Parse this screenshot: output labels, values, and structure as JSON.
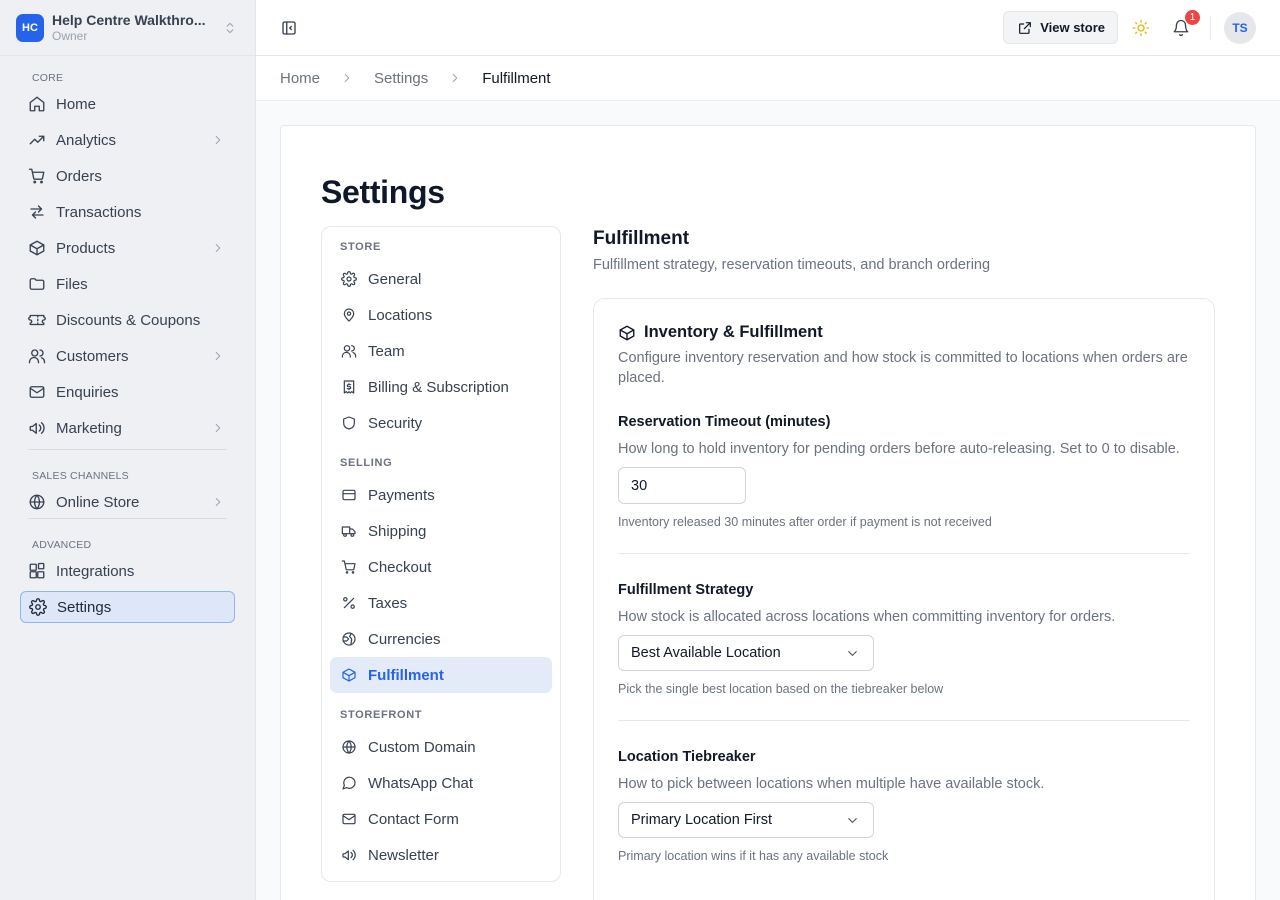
{
  "workspace": {
    "initials": "HC",
    "name": "Help Centre Walkthro...",
    "role": "Owner"
  },
  "sidebar": {
    "sections": [
      {
        "title": "CORE",
        "items": [
          {
            "label": "Home",
            "icon": "home-icon",
            "chevron": false
          },
          {
            "label": "Analytics",
            "icon": "trend-icon",
            "chevron": true
          },
          {
            "label": "Orders",
            "icon": "cart-icon",
            "chevron": false
          },
          {
            "label": "Transactions",
            "icon": "arrows-icon",
            "chevron": false
          },
          {
            "label": "Products",
            "icon": "box-icon",
            "chevron": true
          },
          {
            "label": "Files",
            "icon": "folder-icon",
            "chevron": false
          },
          {
            "label": "Discounts & Coupons",
            "icon": "ticket-icon",
            "chevron": false
          },
          {
            "label": "Customers",
            "icon": "users-icon",
            "chevron": true
          },
          {
            "label": "Enquiries",
            "icon": "mail-icon",
            "chevron": false
          },
          {
            "label": "Marketing",
            "icon": "megaphone-icon",
            "chevron": true
          }
        ]
      },
      {
        "title": "SALES CHANNELS",
        "items": [
          {
            "label": "Online Store",
            "icon": "globe-icon",
            "chevron": true
          }
        ]
      },
      {
        "title": "ADVANCED",
        "items": [
          {
            "label": "Integrations",
            "icon": "blocks-icon",
            "chevron": false
          },
          {
            "label": "Settings",
            "icon": "gear-icon",
            "chevron": false,
            "active": true
          }
        ]
      }
    ]
  },
  "topbar": {
    "view_store": "View store",
    "notifications_count": "1",
    "avatar_initials": "TS"
  },
  "breadcrumb": [
    "Home",
    "Settings",
    "Fulfillment"
  ],
  "page": {
    "title": "Settings"
  },
  "subnav": {
    "sections": [
      {
        "title": "STORE",
        "items": [
          {
            "label": "General",
            "icon": "gear-icon"
          },
          {
            "label": "Locations",
            "icon": "pin-icon"
          },
          {
            "label": "Team",
            "icon": "users-icon"
          },
          {
            "label": "Billing & Subscription",
            "icon": "receipt-icon"
          },
          {
            "label": "Security",
            "icon": "shield-icon"
          }
        ]
      },
      {
        "title": "SELLING",
        "items": [
          {
            "label": "Payments",
            "icon": "card-icon"
          },
          {
            "label": "Shipping",
            "icon": "truck-icon"
          },
          {
            "label": "Checkout",
            "icon": "cart-icon"
          },
          {
            "label": "Taxes",
            "icon": "percent-icon"
          },
          {
            "label": "Currencies",
            "icon": "coins-icon"
          },
          {
            "label": "Fulfillment",
            "icon": "box-icon",
            "active": true
          }
        ]
      },
      {
        "title": "STOREFRONT",
        "items": [
          {
            "label": "Custom Domain",
            "icon": "globe-icon"
          },
          {
            "label": "WhatsApp Chat",
            "icon": "chat-icon"
          },
          {
            "label": "Contact Form",
            "icon": "mail-icon"
          },
          {
            "label": "Newsletter",
            "icon": "megaphone-icon"
          }
        ]
      }
    ]
  },
  "content": {
    "title": "Fulfillment",
    "description": "Fulfillment strategy, reservation timeouts, and branch ordering",
    "panel": {
      "title": "Inventory & Fulfillment",
      "description": "Configure inventory reservation and how stock is committed to locations when orders are placed.",
      "reservation": {
        "label": "Reservation Timeout (minutes)",
        "description": "How long to hold inventory for pending orders before auto-releasing. Set to 0 to disable.",
        "value": "30",
        "hint": "Inventory released 30 minutes after order if payment is not received"
      },
      "strategy": {
        "label": "Fulfillment Strategy",
        "description": "How stock is allocated across locations when committing inventory for orders.",
        "value": "Best Available Location",
        "hint": "Pick the single best location based on the tiebreaker below"
      },
      "tiebreaker": {
        "label": "Location Tiebreaker",
        "description": "How to pick between locations when multiple have available stock.",
        "value": "Primary Location First",
        "hint": "Primary location wins if it has any available stock"
      }
    }
  }
}
